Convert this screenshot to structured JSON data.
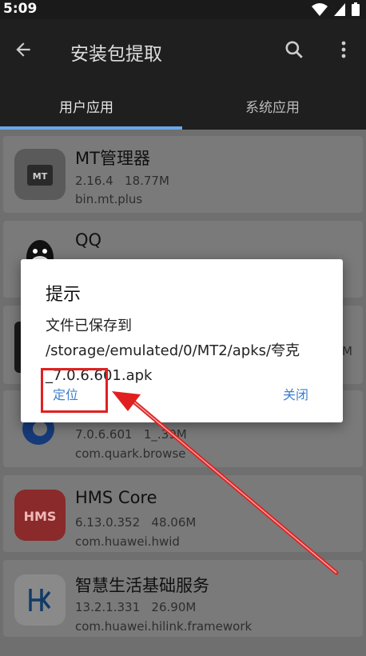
{
  "status": {
    "time": "5:09"
  },
  "toolbar": {
    "title": "安装包提取"
  },
  "tabs": [
    {
      "label": "用户应用"
    },
    {
      "label": "系统应用"
    }
  ],
  "apps": [
    {
      "name": "MT管理器",
      "version": "2.16.4",
      "size": "18.77M",
      "package": "bin.mt.plus"
    },
    {
      "name": "QQ",
      "version": "",
      "size": "",
      "package": ""
    },
    {
      "name": "",
      "version": "",
      "size": "",
      "package": ""
    },
    {
      "name": "",
      "version": "7.0.6.601",
      "size": "1_.39M",
      "package": "com.quark.browse"
    },
    {
      "name": "HMS Core",
      "version": "6.13.0.352",
      "size": "48.06M",
      "package": "com.huawei.hwid"
    },
    {
      "name": "智慧生活基础服务",
      "version": "13.2.1.331",
      "size": "26.90M",
      "package": "com.huawei.hilink.framework"
    }
  ],
  "dialog": {
    "title": "提示",
    "message": "文件已保存到 /storage/emulated/0/MT2/apks/夸克_7.0.6.601.apk",
    "locate_label": "定位",
    "close_label": "关闭"
  },
  "colors": {
    "accent": "#6aa6ea",
    "dialog_button": "#3d7fcf",
    "annotation": "#e02020"
  },
  "icons": [
    "back-arrow-icon",
    "search-icon",
    "more-vert-icon",
    "wifi-icon",
    "signal-icon",
    "battery-icon"
  ]
}
